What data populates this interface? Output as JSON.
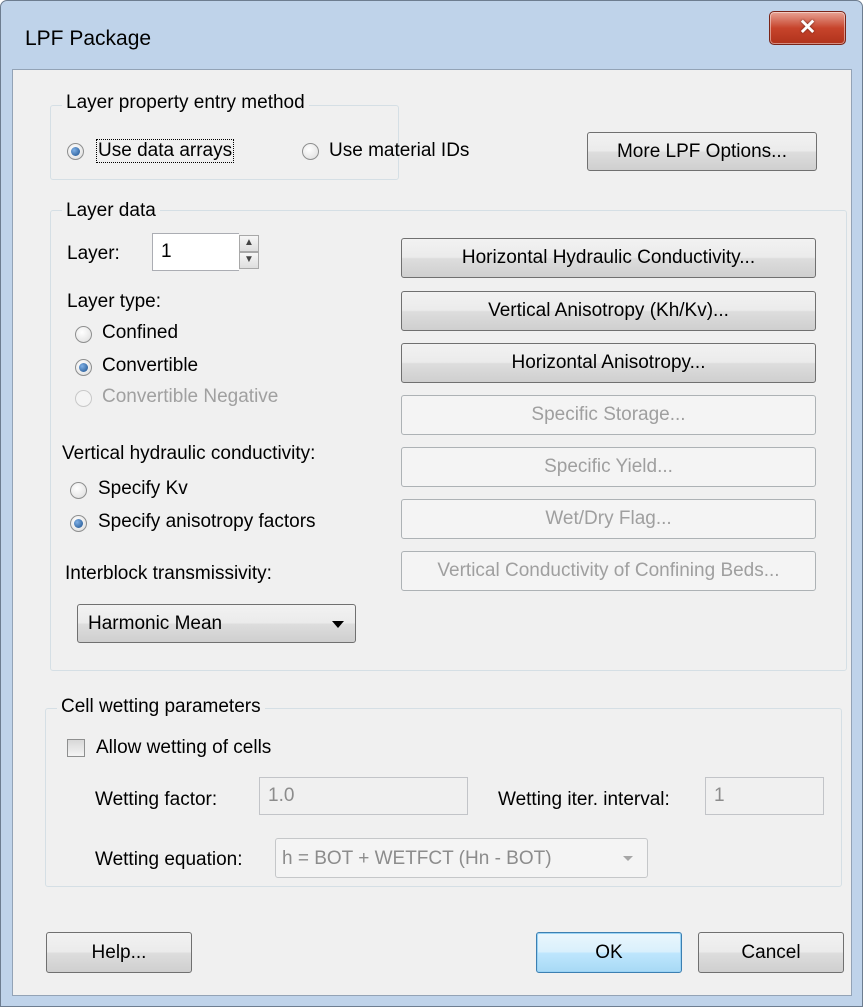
{
  "window": {
    "title": "LPF Package",
    "close_glyph": "✕"
  },
  "entry_method": {
    "group_label": "Layer property entry method",
    "option_arrays": "Use data arrays",
    "option_materials": "Use material IDs",
    "selected": "Use data arrays",
    "more_options_button": "More LPF Options..."
  },
  "layer_data": {
    "group_label": "Layer data",
    "layer_label": "Layer:",
    "layer_value": "1",
    "layer_type_label": "Layer type:",
    "layer_type_options": [
      "Confined",
      "Convertible",
      "Convertible Negative"
    ],
    "layer_type_selected": "Convertible",
    "vertical_k_label": "Vertical hydraulic conductivity:",
    "vertical_k_options": [
      "Specify Kv",
      "Specify anisotropy factors"
    ],
    "vertical_k_selected": "Specify anisotropy factors",
    "interblock_label": "Interblock transmissivity:",
    "interblock_value": "Harmonic Mean",
    "buttons": {
      "horizontal_k": "Horizontal Hydraulic Conductivity...",
      "vertical_anisotropy": "Vertical Anisotropy (Kh/Kv)...",
      "horizontal_anisotropy": "Horizontal Anisotropy...",
      "specific_storage": "Specific Storage...",
      "specific_yield": "Specific Yield...",
      "wet_dry_flag": "Wet/Dry Flag...",
      "vertical_confining": "Vertical Conductivity of Confining Beds..."
    }
  },
  "wetting": {
    "group_label": "Cell wetting parameters",
    "allow_label": "Allow wetting of cells",
    "allow_checked": false,
    "factor_label": "Wetting factor:",
    "factor_value": "1.0",
    "interval_label": "Wetting iter. interval:",
    "interval_value": "1",
    "equation_label": "Wetting equation:",
    "equation_value": "h = BOT + WETFCT (Hn - BOT)"
  },
  "footer": {
    "help_button": "Help...",
    "ok_button": "OK",
    "cancel_button": "Cancel"
  }
}
